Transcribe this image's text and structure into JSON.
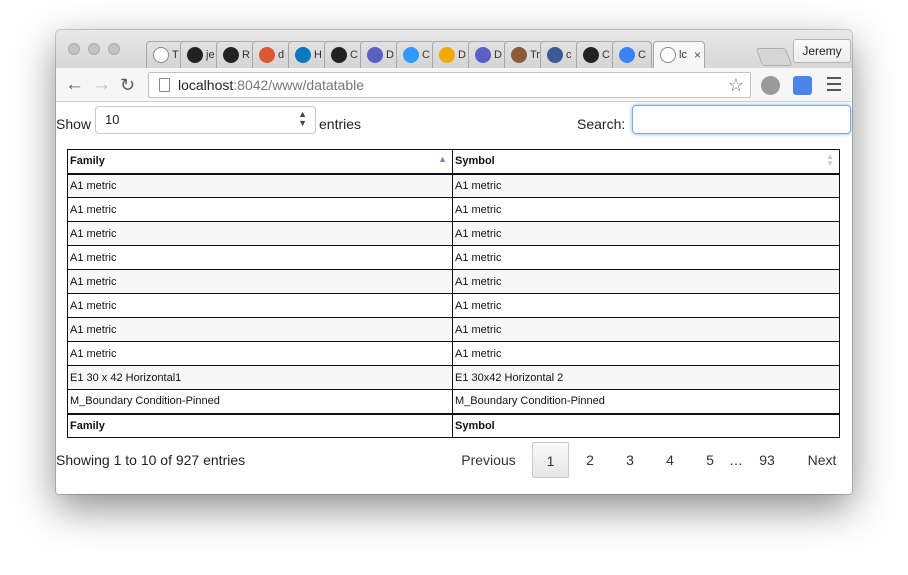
{
  "browser": {
    "tabs": [
      {
        "letter": "T",
        "icon": "page-icon",
        "color": "#ffffff"
      },
      {
        "letter": "je",
        "icon": "github-icon",
        "color": "#222222"
      },
      {
        "letter": "R",
        "icon": "github-icon",
        "color": "#222222"
      },
      {
        "letter": "d",
        "icon": "duckduckgo-icon",
        "color": "#de5833"
      },
      {
        "letter": "H",
        "icon": "drupal-icon",
        "color": "#0678be"
      },
      {
        "letter": "C",
        "icon": "github-icon",
        "color": "#222222"
      },
      {
        "letter": "D",
        "icon": "circle-icon",
        "color": "#5b5fc7"
      },
      {
        "letter": "C",
        "icon": "squares-icon",
        "color": "#3399ff"
      },
      {
        "letter": "D",
        "icon": "fund-icon",
        "color": "#f2a900"
      },
      {
        "letter": "D",
        "icon": "circle-icon",
        "color": "#5b5fc7"
      },
      {
        "letter": "Tr",
        "icon": "avatar-icon",
        "color": "#8a5a3b"
      },
      {
        "letter": "c",
        "icon": "h-icon",
        "color": "#3d5a98"
      },
      {
        "letter": "C",
        "icon": "github-icon",
        "color": "#222222"
      },
      {
        "letter": "C",
        "icon": "diamond-icon",
        "color": "#3b82f6"
      },
      {
        "letter": "lc",
        "icon": "page-icon",
        "color": "#ffffff",
        "active": true
      }
    ],
    "profile_name": "Jeremy",
    "url_host": "localhost",
    "url_path": ":8042/www/datatable"
  },
  "controls": {
    "show_label": "Show",
    "page_length": "10",
    "entries_label": "entries",
    "search_label": "Search:",
    "search_value": ""
  },
  "table": {
    "headers": [
      "Family",
      "Symbol"
    ],
    "rows": [
      [
        "A1 metric",
        "A1 metric"
      ],
      [
        "A1 metric",
        "A1 metric"
      ],
      [
        "A1 metric",
        "A1 metric"
      ],
      [
        "A1 metric",
        "A1 metric"
      ],
      [
        "A1 metric",
        "A1 metric"
      ],
      [
        "A1 metric",
        "A1 metric"
      ],
      [
        "A1 metric",
        "A1 metric"
      ],
      [
        "A1 metric",
        "A1 metric"
      ],
      [
        "E1 30 x 42 Horizontal1",
        "E1 30x42 Horizontal 2"
      ],
      [
        "M_Boundary Condition-Pinned",
        "M_Boundary Condition-Pinned"
      ]
    ],
    "footers": [
      "Family",
      "Symbol"
    ]
  },
  "footer": {
    "info": "Showing 1 to 10 of 927 entries",
    "previous": "Previous",
    "pages": [
      "1",
      "2",
      "3",
      "4",
      "5"
    ],
    "ellipsis": "…",
    "last_page": "93",
    "next": "Next",
    "current_page": "1"
  }
}
